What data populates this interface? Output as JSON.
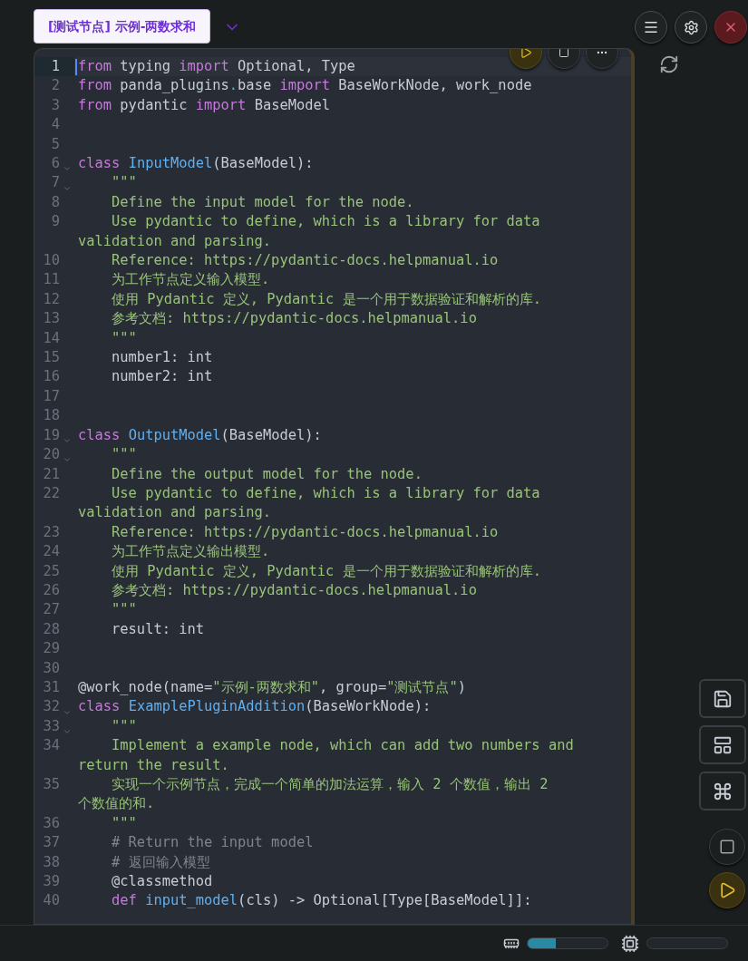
{
  "header": {
    "node_title": "[测试节点] 示例-两数求和"
  },
  "editor": {
    "lines": [
      {
        "number": "1",
        "current": true,
        "foldable": false,
        "rows": [
          [
            {
              "kind": "keyword",
              "text": "from"
            },
            {
              "kind": "plain",
              "text": " typing "
            },
            {
              "kind": "keyword",
              "text": "import"
            },
            {
              "kind": "plain",
              "text": " Optional, Type"
            }
          ]
        ]
      },
      {
        "number": "2",
        "current": false,
        "foldable": false,
        "rows": [
          [
            {
              "kind": "keyword",
              "text": "from"
            },
            {
              "kind": "plain",
              "text": " panda_plugins"
            },
            {
              "kind": "operator",
              "text": "."
            },
            {
              "kind": "plain",
              "text": "base "
            },
            {
              "kind": "keyword",
              "text": "import"
            },
            {
              "kind": "plain",
              "text": " BaseWorkNode, work_node"
            }
          ]
        ]
      },
      {
        "number": "3",
        "current": false,
        "foldable": false,
        "rows": [
          [
            {
              "kind": "keyword",
              "text": "from"
            },
            {
              "kind": "plain",
              "text": " pydantic "
            },
            {
              "kind": "keyword",
              "text": "import"
            },
            {
              "kind": "plain",
              "text": " BaseModel"
            }
          ]
        ]
      },
      {
        "number": "4",
        "current": false,
        "foldable": false
      },
      {
        "number": "5",
        "current": false,
        "foldable": false
      },
      {
        "number": "6",
        "current": false,
        "foldable": true,
        "rows": [
          [
            {
              "kind": "keyword",
              "text": "class"
            },
            {
              "kind": "plain",
              "text": " "
            },
            {
              "kind": "name",
              "text": "InputModel"
            },
            {
              "kind": "plain",
              "text": "(BaseModel):"
            }
          ]
        ]
      },
      {
        "number": "7",
        "current": false,
        "foldable": true,
        "rows": [
          [
            {
              "kind": "string",
              "text": "    \"\"\""
            }
          ]
        ]
      },
      {
        "number": "8",
        "current": false,
        "foldable": false,
        "rows": [
          [
            {
              "kind": "string",
              "text": "    Define the input model for the node."
            }
          ]
        ]
      },
      {
        "number": "9",
        "current": false,
        "foldable": false,
        "rows": [
          [
            {
              "kind": "string",
              "text": "    Use pydantic to define, which is a library for data"
            }
          ],
          [
            {
              "kind": "string",
              "text": "validation and parsing."
            }
          ]
        ]
      },
      {
        "number": "10",
        "current": false,
        "foldable": false,
        "rows": [
          [
            {
              "kind": "string",
              "text": "    Reference: https://pydantic-docs.helpmanual.io"
            }
          ]
        ]
      },
      {
        "number": "11",
        "current": false,
        "foldable": false,
        "rows": [
          [
            {
              "kind": "string",
              "text": "    为工作节点定义输入模型."
            }
          ]
        ]
      },
      {
        "number": "12",
        "current": false,
        "foldable": false,
        "rows": [
          [
            {
              "kind": "string",
              "text": "    使用 Pydantic 定义, Pydantic 是一个用于数据验证和解析的库."
            }
          ]
        ]
      },
      {
        "number": "13",
        "current": false,
        "foldable": false,
        "rows": [
          [
            {
              "kind": "string",
              "text": "    参考文档: https://pydantic-docs.helpmanual.io"
            }
          ]
        ]
      },
      {
        "number": "14",
        "current": false,
        "foldable": false,
        "rows": [
          [
            {
              "kind": "string",
              "text": "    \"\"\""
            }
          ]
        ]
      },
      {
        "number": "15",
        "current": false,
        "foldable": false,
        "rows": [
          [
            {
              "kind": "plain",
              "text": "    number1: int"
            }
          ]
        ]
      },
      {
        "number": "16",
        "current": false,
        "foldable": false,
        "rows": [
          [
            {
              "kind": "plain",
              "text": "    number2: int"
            }
          ]
        ]
      },
      {
        "number": "17",
        "current": false,
        "foldable": false
      },
      {
        "number": "18",
        "current": false,
        "foldable": false
      },
      {
        "number": "19",
        "current": false,
        "foldable": true,
        "rows": [
          [
            {
              "kind": "keyword",
              "text": "class"
            },
            {
              "kind": "plain",
              "text": " "
            },
            {
              "kind": "name",
              "text": "OutputModel"
            },
            {
              "kind": "plain",
              "text": "(BaseModel):"
            }
          ]
        ]
      },
      {
        "number": "20",
        "current": false,
        "foldable": true,
        "rows": [
          [
            {
              "kind": "string",
              "text": "    \"\"\""
            }
          ]
        ]
      },
      {
        "number": "21",
        "current": false,
        "foldable": false,
        "rows": [
          [
            {
              "kind": "string",
              "text": "    Define the output model for the node."
            }
          ]
        ]
      },
      {
        "number": "22",
        "current": false,
        "foldable": false,
        "rows": [
          [
            {
              "kind": "string",
              "text": "    Use pydantic to define, which is a library for data"
            }
          ],
          [
            {
              "kind": "string",
              "text": "validation and parsing."
            }
          ]
        ]
      },
      {
        "number": "23",
        "current": false,
        "foldable": false,
        "rows": [
          [
            {
              "kind": "string",
              "text": "    Reference: https://pydantic-docs.helpmanual.io"
            }
          ]
        ]
      },
      {
        "number": "24",
        "current": false,
        "foldable": false,
        "rows": [
          [
            {
              "kind": "string",
              "text": "    为工作节点定义输出模型."
            }
          ]
        ]
      },
      {
        "number": "25",
        "current": false,
        "foldable": false,
        "rows": [
          [
            {
              "kind": "string",
              "text": "    使用 Pydantic 定义, Pydantic 是一个用于数据验证和解析的库."
            }
          ]
        ]
      },
      {
        "number": "26",
        "current": false,
        "foldable": false,
        "rows": [
          [
            {
              "kind": "string",
              "text": "    参考文档: https://pydantic-docs.helpmanual.io"
            }
          ]
        ]
      },
      {
        "number": "27",
        "current": false,
        "foldable": false,
        "rows": [
          [
            {
              "kind": "string",
              "text": "    \"\"\""
            }
          ]
        ]
      },
      {
        "number": "28",
        "current": false,
        "foldable": false,
        "rows": [
          [
            {
              "kind": "plain",
              "text": "    result: int"
            }
          ]
        ]
      },
      {
        "number": "29",
        "current": false,
        "foldable": false
      },
      {
        "number": "30",
        "current": false,
        "foldable": false
      },
      {
        "number": "31",
        "current": false,
        "foldable": false,
        "rows": [
          [
            {
              "kind": "plain",
              "text": "@work_node(name="
            },
            {
              "kind": "string",
              "text": "\"示例-两数求和\""
            },
            {
              "kind": "plain",
              "text": ", group="
            },
            {
              "kind": "string",
              "text": "\"测试节点\""
            },
            {
              "kind": "plain",
              "text": ")"
            }
          ]
        ]
      },
      {
        "number": "32",
        "current": false,
        "foldable": true,
        "rows": [
          [
            {
              "kind": "keyword",
              "text": "class"
            },
            {
              "kind": "plain",
              "text": " "
            },
            {
              "kind": "name",
              "text": "ExamplePluginAddition"
            },
            {
              "kind": "plain",
              "text": "(BaseWorkNode):"
            }
          ]
        ]
      },
      {
        "number": "33",
        "current": false,
        "foldable": true,
        "rows": [
          [
            {
              "kind": "string",
              "text": "    \"\"\""
            }
          ]
        ]
      },
      {
        "number": "34",
        "current": false,
        "foldable": false,
        "rows": [
          [
            {
              "kind": "string",
              "text": "    Implement a example node, which can add two numbers and"
            }
          ],
          [
            {
              "kind": "string",
              "text": "return the result."
            }
          ]
        ]
      },
      {
        "number": "35",
        "current": false,
        "foldable": false,
        "rows": [
          [
            {
              "kind": "string",
              "text": "    实现一个示例节点，完成一个简单的加法运算，输入 2 个数值，输出 2"
            }
          ],
          [
            {
              "kind": "string",
              "text": "个数值的和."
            }
          ]
        ]
      },
      {
        "number": "36",
        "current": false,
        "foldable": false,
        "rows": [
          [
            {
              "kind": "string",
              "text": "    \"\"\""
            }
          ]
        ]
      },
      {
        "number": "37",
        "current": false,
        "foldable": false,
        "rows": [
          [
            {
              "kind": "comment",
              "text": "    # Return the input model"
            }
          ]
        ]
      },
      {
        "number": "38",
        "current": false,
        "foldable": false,
        "rows": [
          [
            {
              "kind": "comment",
              "text": "    # 返回输入模型"
            }
          ]
        ]
      },
      {
        "number": "39",
        "current": false,
        "foldable": false,
        "rows": [
          [
            {
              "kind": "plain",
              "text": "    @classmethod"
            }
          ]
        ]
      },
      {
        "number": "40",
        "current": false,
        "foldable": false,
        "rows": [
          [
            {
              "kind": "plain",
              "text": "    "
            },
            {
              "kind": "keyword",
              "text": "def"
            },
            {
              "kind": "plain",
              "text": " "
            },
            {
              "kind": "name",
              "text": "input_model"
            },
            {
              "kind": "plain",
              "text": "(cls) -> Optional[Type[BaseModel]]:"
            }
          ]
        ]
      }
    ]
  },
  "status_bar": {
    "memory": {
      "level": 0.35
    },
    "cpu": {
      "level": 0
    }
  }
}
